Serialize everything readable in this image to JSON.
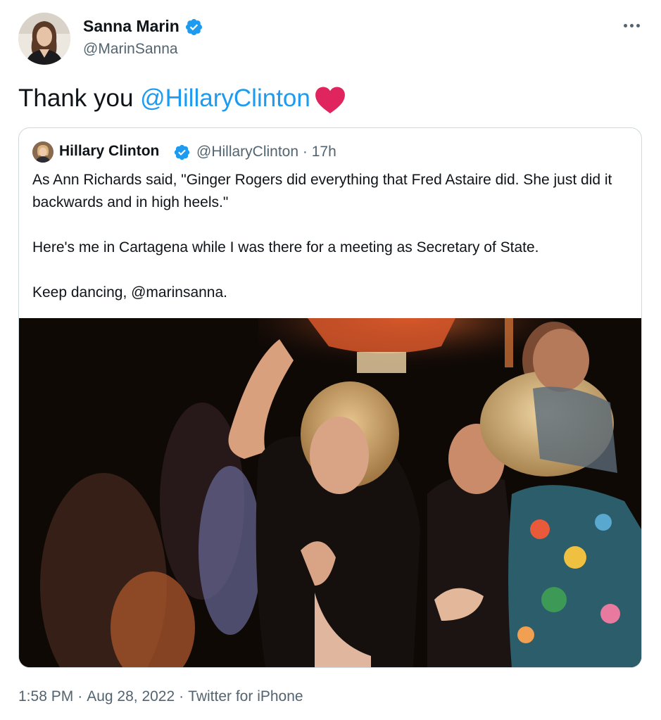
{
  "author": {
    "name": "Sanna Marin",
    "handle": "@MarinSanna",
    "verified": true,
    "avatar_icon": "profile-photo"
  },
  "tweet": {
    "text": "Thank you ",
    "mention": "@HillaryClinton",
    "emoji": "red-heart-icon"
  },
  "quoted": {
    "name": "Hillary Clinton",
    "handle": "@HillaryClinton",
    "separator": "·",
    "time": "17h",
    "paragraphs": [
      "As Ann Richards said, \"Ginger Rogers did everything that Fred Astaire did. She just did it backwards and in high heels.\"",
      "Here's me in Cartagena while I was there for a meeting as Secretary of State."
    ],
    "last_line": {
      "text": "Keep dancing, ",
      "mention": "@marinsanna",
      "suffix": "."
    },
    "media": "photo of people dancing"
  },
  "footer": {
    "time": "1:58 PM",
    "date": "Aug 28, 2022",
    "source": "Twitter for iPhone",
    "separator": "·"
  },
  "colors": {
    "text": "#0f1419",
    "secondary": "#536471",
    "link": "#1d9bf0",
    "verified": "#1d9bf0",
    "heart": "#e0245e",
    "border": "#cfd9de"
  }
}
